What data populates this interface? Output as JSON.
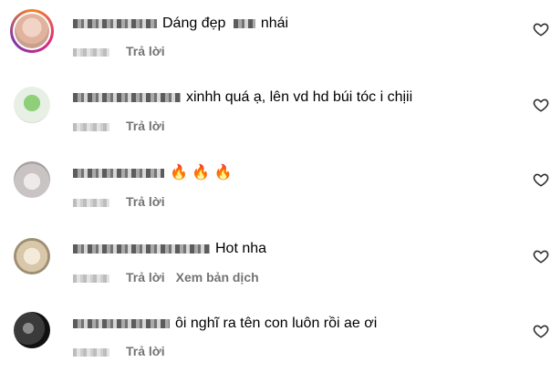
{
  "comments": [
    {
      "text": "Dáng đẹp",
      "text_tail": "nhái",
      "reply_label": "Trả lời",
      "translate_label": ""
    },
    {
      "text": "xinhh quá ạ, lên vd hd búi tóc i chịii",
      "reply_label": "Trả lời",
      "translate_label": ""
    },
    {
      "text": "🔥 🔥 🔥",
      "reply_label": "Trả lời",
      "translate_label": ""
    },
    {
      "text": "Hot nha",
      "reply_label": "Trả lời",
      "translate_label": "Xem bản dịch"
    },
    {
      "text": "ôi nghĩ ra tên con luôn rồi ae ơi",
      "reply_label": "Trả lời",
      "translate_label": ""
    }
  ],
  "icons": {
    "heart": "heart-outline-icon",
    "flame": "fire-emoji"
  },
  "colors": {
    "text": "#000000",
    "meta": "#737373",
    "story_ring": "#dd2a7b"
  }
}
